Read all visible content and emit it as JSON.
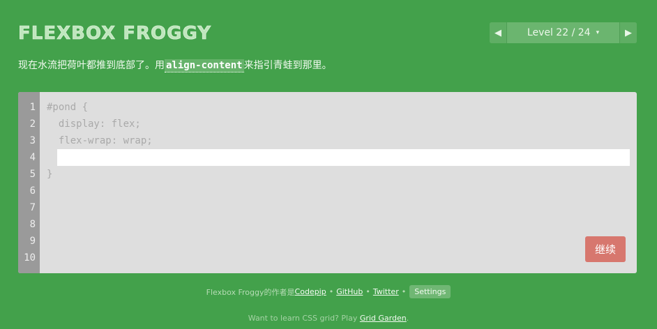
{
  "header": {
    "title": "FLEXBOX FROGGY",
    "level_label": "Level 22 / 24",
    "prev_icon": "◀",
    "next_icon": "▶",
    "caret_icon": "▾"
  },
  "instructions": {
    "before": "现在水流把荷叶都推到底部了。用",
    "code": "align-content",
    "after": "来指引青蛙到那里。"
  },
  "editor": {
    "line_numbers": [
      "1",
      "2",
      "3",
      "4",
      "5",
      "6",
      "7",
      "8",
      "9",
      "10"
    ],
    "lines": {
      "l1": "#pond {",
      "l2": "  display: flex;",
      "l3": "  flex-wrap: wrap;",
      "l5": "}"
    },
    "input_value": "",
    "next_button_label": "继续"
  },
  "footer": {
    "credits_prefix": "Flexbox Froggy的作者是 ",
    "links": {
      "codepip": "Codepip",
      "github": "GitHub",
      "twitter": "Twitter"
    },
    "separator": "•",
    "settings_label": "Settings",
    "promo_prefix": "Want to learn CSS grid? Play ",
    "promo_link": "Grid Garden",
    "promo_suffix": "."
  },
  "colors": {
    "background": "#43a14b",
    "editor_bg": "#dedede",
    "gutter_bg": "#9a9a9a",
    "next_button": "#d7776e"
  }
}
